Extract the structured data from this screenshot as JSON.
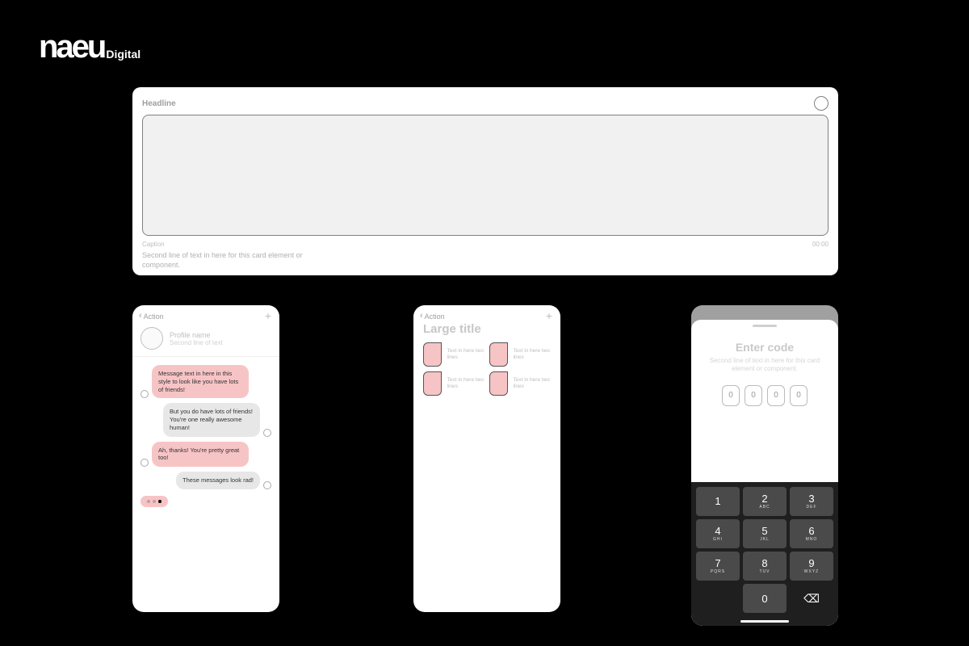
{
  "logo": {
    "brand": "naeu",
    "suffix": "Digital"
  },
  "card": {
    "headline": "Headline",
    "caption": "Caption",
    "timestamp": "00:00",
    "subtitle": "Second line of text in here for this card element or component."
  },
  "chat": {
    "back_label": "Action",
    "profile_name": "Profile name",
    "profile_sub": "Second line of text",
    "messages": [
      {
        "side": "left",
        "style": "pink",
        "text": "Message text in here in this style to look like you have lots of friends!"
      },
      {
        "side": "right",
        "style": "grey",
        "text": "But you do have lots of friends! You're one really awesome human!"
      },
      {
        "side": "left",
        "style": "pink",
        "text": "Ah, thanks! You're pretty great too!"
      },
      {
        "side": "right",
        "style": "grey",
        "text": "These messages look rad!"
      }
    ]
  },
  "grid": {
    "back_label": "Action",
    "large_title": "Large title",
    "tile_text": "Text in here two lines"
  },
  "code": {
    "title": "Enter code",
    "subtitle": "Second line of text in here for this card element or component.",
    "digits": [
      "0",
      "0",
      "0",
      "0"
    ],
    "keys": [
      {
        "n": "1",
        "l": ""
      },
      {
        "n": "2",
        "l": "ABC"
      },
      {
        "n": "3",
        "l": "DEF"
      },
      {
        "n": "4",
        "l": "GHI"
      },
      {
        "n": "5",
        "l": "JKL"
      },
      {
        "n": "6",
        "l": "MNO"
      },
      {
        "n": "7",
        "l": "PQRS"
      },
      {
        "n": "8",
        "l": "TUV"
      },
      {
        "n": "9",
        "l": "WXYZ"
      }
    ],
    "zero": "0"
  }
}
